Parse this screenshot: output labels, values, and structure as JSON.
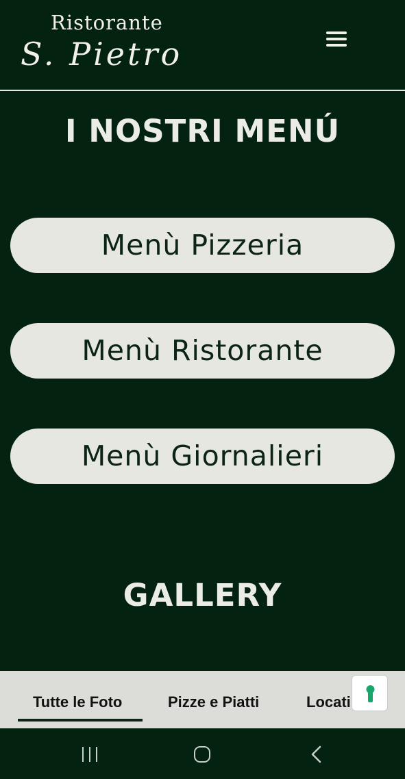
{
  "header": {
    "logo_line1": "Ristorante",
    "logo_line2": "S. Pietro",
    "menu_icon": "hamburger-menu-icon"
  },
  "menus_section": {
    "title": "I NOSTRI MENÚ",
    "buttons": [
      {
        "label": "Menù Pizzeria"
      },
      {
        "label": "Menù Ristorante"
      },
      {
        "label": "Menù Giornalieri"
      }
    ]
  },
  "gallery": {
    "title": "GALLERY",
    "tabs": [
      {
        "label": "Tutte le Foto",
        "active": true
      },
      {
        "label": "Pizze e Piatti",
        "active": false
      },
      {
        "label": "Locati",
        "active": false
      }
    ]
  },
  "cookie_button": {
    "icon": "keyhole-icon",
    "color": "#16a86b"
  },
  "system_nav": {
    "icons": [
      "recent-apps-icon",
      "home-icon",
      "back-icon"
    ]
  },
  "colors": {
    "background": "#032210",
    "button": "#e7e7e1",
    "text_light": "#ecece6",
    "tabbar": "#dcdcd8"
  }
}
